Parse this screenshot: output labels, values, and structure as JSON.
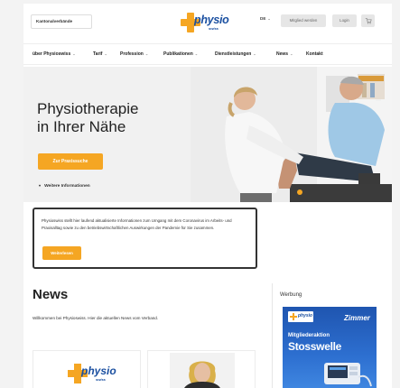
{
  "topbar": {
    "kanton_label": "Kantonalverbände",
    "logo_word": "physio",
    "logo_sub": "swiss",
    "language": "DE",
    "member_button": "Mitglied werden",
    "login_button": "Login"
  },
  "nav": {
    "items": [
      {
        "label": "über Physioswiss"
      },
      {
        "label": "Tarif"
      },
      {
        "label": "Profession"
      },
      {
        "label": "Publikationen"
      },
      {
        "label": "Dienstleistungen"
      },
      {
        "label": "News"
      },
      {
        "label": "Kontakt"
      }
    ]
  },
  "hero": {
    "title_line1": "Physiotherapie",
    "title_line2": "in Ihrer Nähe",
    "cta_button": "Zur Praxissuche",
    "more_info": "Weitere Informationen"
  },
  "notice": {
    "text": "Physioswiss stellt hier laufend aktualisierte Informationen zum Umgang mit dem Coronavirus im Arbeits- und Praxisalltag sowie zu den betriebswirtschaftlichen Auswirkungen der Pandemie für Sie zusammen.",
    "button": "Weiterlesen"
  },
  "news": {
    "title": "News",
    "intro": "Willkommen bei Physioswiss. Hier die aktuellen News vom Verband.",
    "card1_logo_word": "physio",
    "card1_logo_sub": "swiss"
  },
  "sidebar": {
    "title": "Werbung",
    "ad": {
      "logo_word": "physio",
      "brand": "Zimmer",
      "line1": "Mitgliederaktion",
      "line2": "Stosswelle"
    }
  },
  "colors": {
    "accent_orange": "#f5a623",
    "brand_blue": "#1a4fa0",
    "ad_blue": "#1f55b0"
  }
}
